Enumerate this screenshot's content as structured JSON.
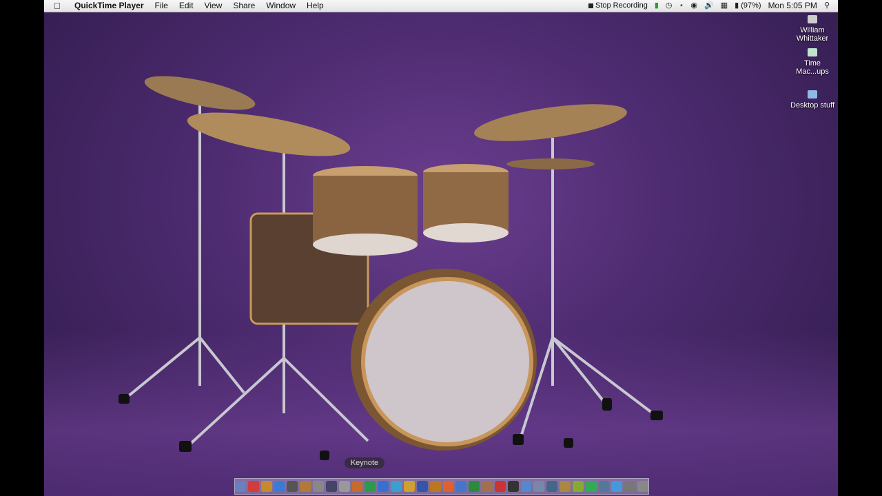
{
  "menubar": {
    "apple_icon": "apple-icon",
    "app_name": "QuickTime Player",
    "menus": [
      "File",
      "Edit",
      "View",
      "Share",
      "Window",
      "Help"
    ],
    "stop_recording": "Stop Recording",
    "battery": "(97%)",
    "clock": "Mon 5:05 PM"
  },
  "desktop_icons": [
    {
      "label": "William Whittaker",
      "icon": "hard-drive-icon"
    },
    {
      "label": "Time Mac...ups",
      "icon": "time-machine-drive-icon"
    },
    {
      "label": "Desktop stuff",
      "icon": "folder-icon"
    }
  ],
  "dock": {
    "tooltip": "Keynote",
    "item_colors": [
      "#6a7fbf",
      "#d23c3c",
      "#c58a2e",
      "#3a7bd5",
      "#555",
      "#b07a3a",
      "#888",
      "#446",
      "#999",
      "#c96a2a",
      "#2a9b4a",
      "#3a6fd0",
      "#3aa0d0",
      "#cfa030",
      "#3355aa",
      "#bb7722",
      "#e06030",
      "#4477cc",
      "#2b8a3e",
      "#a07050",
      "#cc3333",
      "#333",
      "#5588cc",
      "#7788aa",
      "#446688",
      "#aa8844",
      "#88aa33",
      "#33aa55",
      "#557799",
      "#4499dd",
      "#777",
      "#888"
    ]
  }
}
